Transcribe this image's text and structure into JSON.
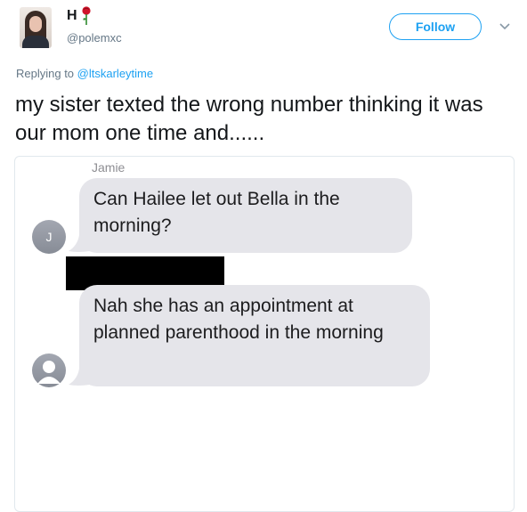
{
  "tweet": {
    "display_name": "H",
    "handle": "@polemxc",
    "follow_label": "Follow",
    "reply_prefix": "Replying to",
    "reply_mention": "@ltskarleytime",
    "text": "my sister texted the wrong number thinking it was our mom one time and......"
  },
  "screenshot": {
    "sender_name": "Jamie",
    "messages": [
      {
        "text": "Can Hailee let out Bella in the morning?",
        "avatar_initial": "J"
      },
      {
        "text": "Nah she has an appointment at planned parenthood in the morning",
        "avatar_initial": ""
      }
    ]
  },
  "colors": {
    "accent": "#1da1f2",
    "secondary_text": "#657786",
    "bubble": "#e5e5ea",
    "redaction": "#000000"
  },
  "icons": {
    "name_emoji": "rose-icon",
    "menu": "chevron-down-icon",
    "unknown_contact": "person-silhouette-icon"
  }
}
